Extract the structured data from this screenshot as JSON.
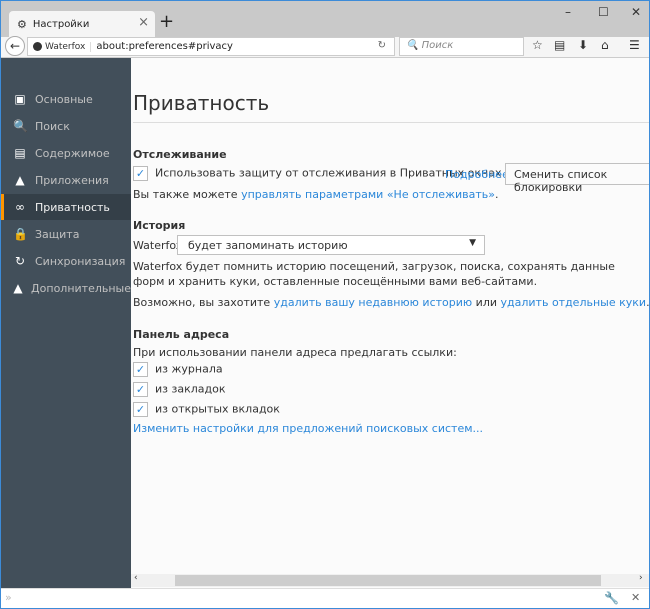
{
  "tab": {
    "title": "Настройки"
  },
  "nav": {
    "identity": "Waterfox",
    "url": "about:preferences#privacy",
    "search_placeholder": "Поиск"
  },
  "sidebar": {
    "items": [
      {
        "label": "Основные",
        "icon": "general-icon"
      },
      {
        "label": "Поиск",
        "icon": "search-icon"
      },
      {
        "label": "Содержимое",
        "icon": "content-icon"
      },
      {
        "label": "Приложения",
        "icon": "applications-icon"
      },
      {
        "label": "Приватность",
        "icon": "privacy-mask-icon",
        "selected": true
      },
      {
        "label": "Защита",
        "icon": "security-lock-icon"
      },
      {
        "label": "Синхронизация",
        "icon": "sync-icon"
      },
      {
        "label": "Дополнительные",
        "icon": "advanced-icon"
      }
    ]
  },
  "main": {
    "title": "Приватность",
    "tracking": {
      "heading": "Отслеживание",
      "checkbox": "Использовать защиту от отслеживания в Приватных окнах",
      "checked": true,
      "learn_more": "Подробнее",
      "blocklist_button": "Сменить список блокировки",
      "also_text": "Вы также можете",
      "dnt_link": "управлять параметрами «Не отслеживать»",
      "dnt_end": "."
    },
    "history": {
      "heading": "История",
      "label": "Waterfox:",
      "select_value": "будет запоминать историю",
      "description": "Waterfox будет помнить историю посещений, загрузок, поиска, сохранять данные форм и хранить куки, оставленные посещёнными вами веб-сайтами.",
      "maybe_text": "Возможно, вы захотите",
      "clear_link": "удалить вашу недавнюю историю",
      "or_text": "или",
      "cookies_link": "удалить отдельные куки",
      "end": "."
    },
    "urlbar": {
      "heading": "Панель адреса",
      "intro": "При использовании панели адреса предлагать ссылки:",
      "options": [
        {
          "label": "из журнала",
          "checked": true
        },
        {
          "label": "из закладок",
          "checked": true
        },
        {
          "label": "из открытых вкладок",
          "checked": true
        }
      ],
      "search_link": "Изменить настройки для предложений поисковых систем..."
    }
  },
  "colors": {
    "accent": "#ff9500",
    "sidebar": "#424f5a",
    "link": "#2b87d9"
  }
}
